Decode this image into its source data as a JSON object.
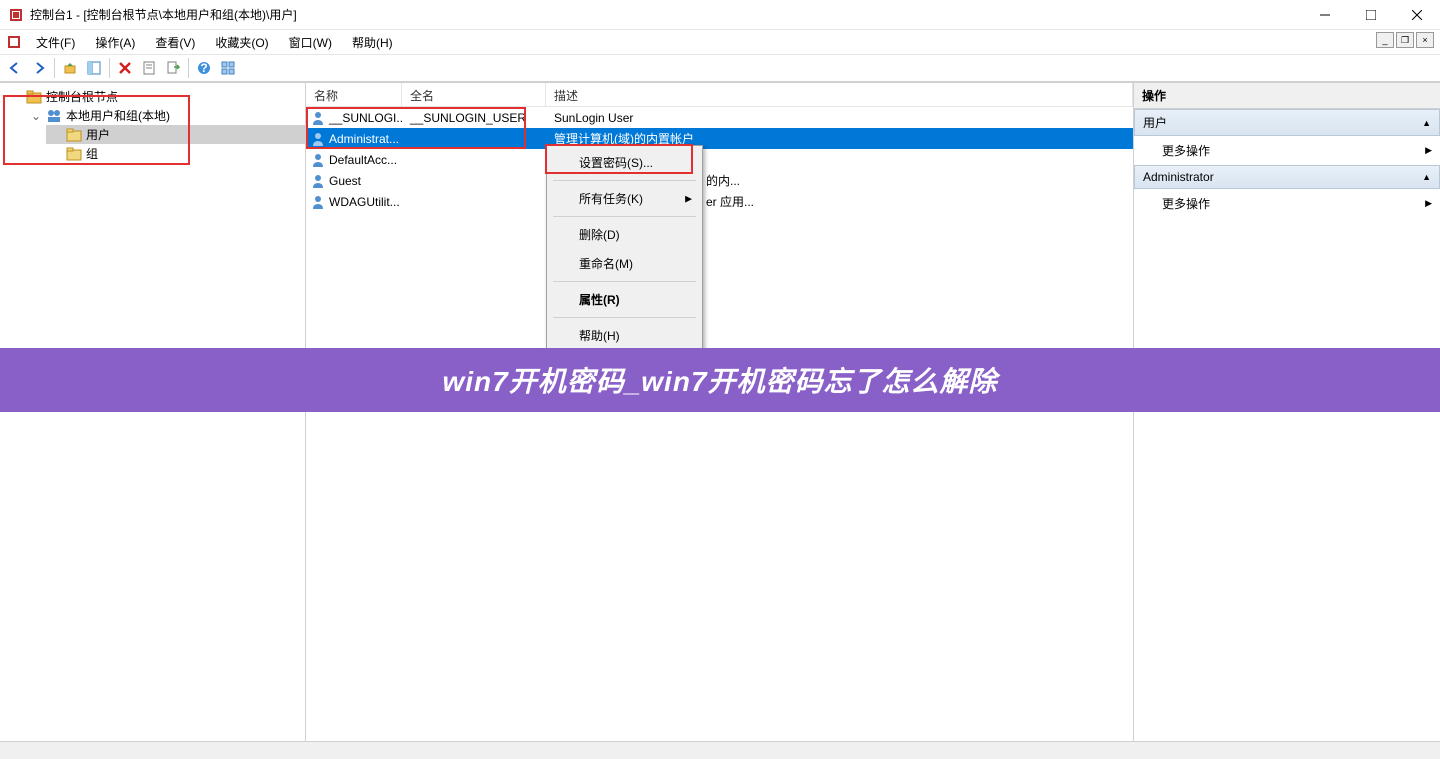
{
  "titlebar": {
    "text": "控制台1 - [控制台根节点\\本地用户和组(本地)\\用户]"
  },
  "menubar": {
    "file": "文件(F)",
    "action": "操作(A)",
    "view": "查看(V)",
    "favorites": "收藏夹(O)",
    "window": "窗口(W)",
    "help": "帮助(H)"
  },
  "tree": {
    "root": "控制台根节点",
    "local_users_groups": "本地用户和组(本地)",
    "users": "用户",
    "groups": "组"
  },
  "list": {
    "headers": {
      "name": "名称",
      "full": "全名",
      "desc": "描述"
    },
    "rows": [
      {
        "name": "__SUNLOGI...",
        "full": "__SUNLOGIN_USER",
        "desc": "SunLogin User"
      },
      {
        "name": "Administrat...",
        "full": "",
        "desc": "管理计算机(域)的内置帐户"
      },
      {
        "name": "DefaultAcc...",
        "full": "",
        "desc": ""
      },
      {
        "name": "Guest",
        "full": "",
        "desc": "的内..."
      },
      {
        "name": "WDAGUtilit...",
        "full": "",
        "desc": "er 应用..."
      }
    ]
  },
  "context_menu": {
    "set_password": "设置密码(S)...",
    "all_tasks": "所有任务(K)",
    "delete": "删除(D)",
    "rename": "重命名(M)",
    "properties": "属性(R)",
    "help": "帮助(H)"
  },
  "actions": {
    "header": "操作",
    "users": "用户",
    "more_actions1": "更多操作",
    "administrator": "Administrator",
    "more_actions2": "更多操作"
  },
  "banner": "win7开机密码_win7开机密码忘了怎么解除"
}
